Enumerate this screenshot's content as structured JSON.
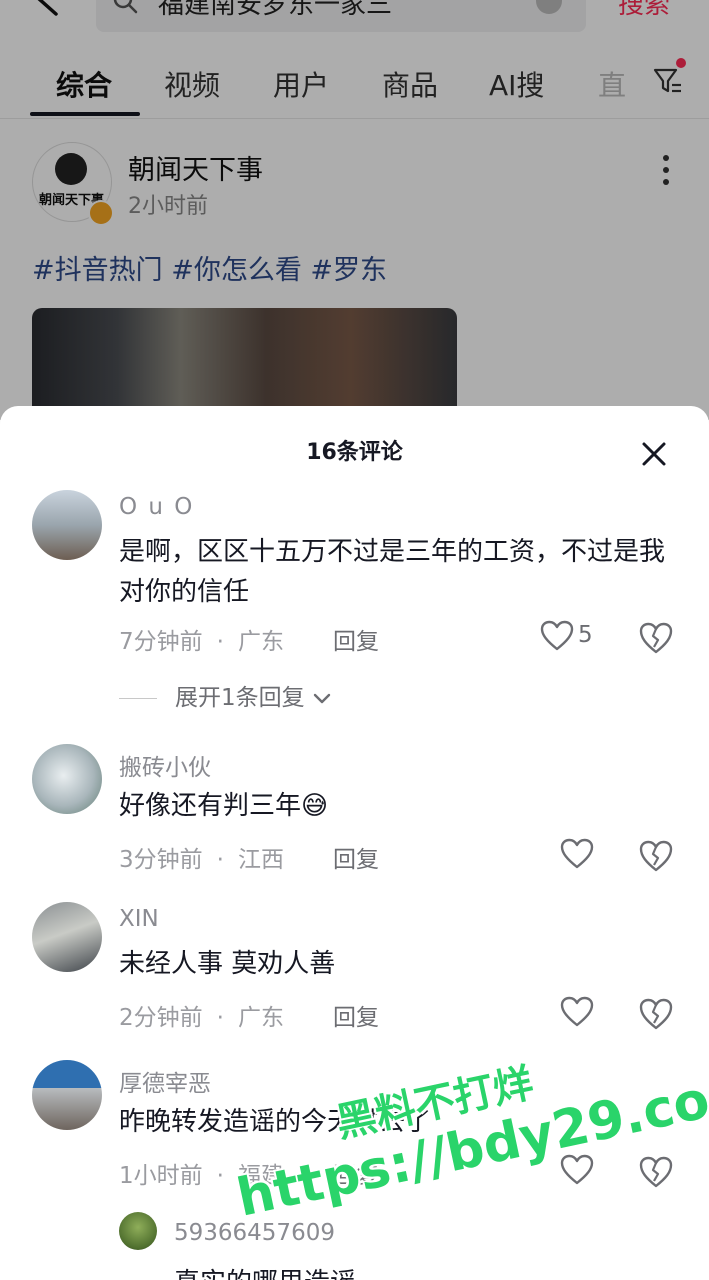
{
  "header": {
    "query": "福建南安罗东一家三",
    "search_label": "搜索"
  },
  "tabs": [
    "综合",
    "视频",
    "用户",
    "商品",
    "AI搜",
    "直"
  ],
  "post": {
    "author": "朝闻天下事",
    "avatar_text": "朝闻天下事",
    "time": "2小时前",
    "hashtags": "#抖音热门 #你怎么看 #罗东"
  },
  "sheet": {
    "title": "16条评论",
    "reply_label": "回复",
    "comments": [
      {
        "user": "O u O",
        "text": "是啊，区区十五万不过是三年的工资，不过是我对你的信任",
        "time": "7分钟前",
        "location": "广东",
        "likes": "5",
        "expand": "展开1条回复"
      },
      {
        "user": "搬砖小伙",
        "text": "好像还有判三年😅",
        "time": "3分钟前",
        "location": "江西"
      },
      {
        "user": "XIN",
        "text": "未经人事 莫劝人善",
        "time": "2分钟前",
        "location": "广东"
      },
      {
        "user": "厚德宰恶",
        "text": "昨晚转发造谣的今天进去了",
        "time": "1小时前",
        "location": "福建"
      }
    ],
    "sub_reply": {
      "user": "59366457609",
      "text": "真实的哪里造谣"
    }
  },
  "watermark": {
    "line1": "黑料不打烊",
    "line2": "https://bdy29.co"
  },
  "colors": {
    "accent": "#fe2c55",
    "hashtag": "#2f4a8a",
    "watermark": "#2ad46a"
  }
}
